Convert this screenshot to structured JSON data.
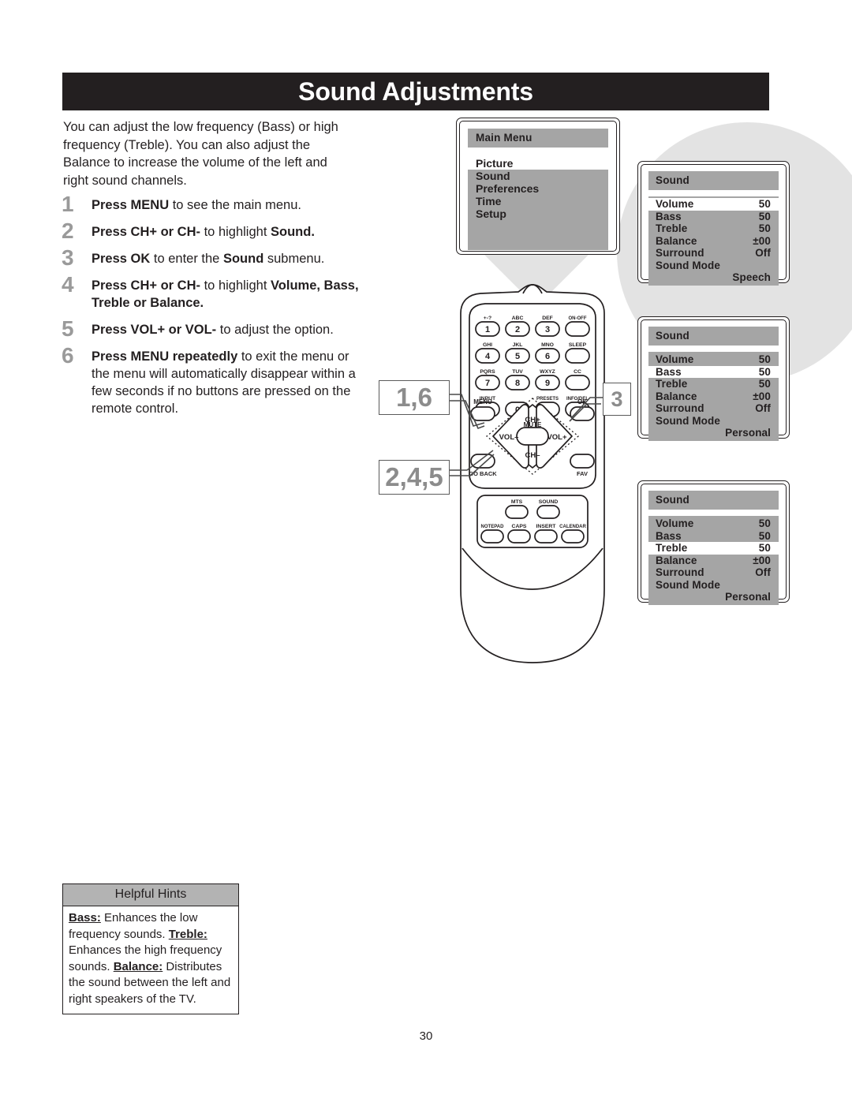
{
  "document": {
    "title": "Sound Adjustments",
    "page_number": "30"
  },
  "intro": {
    "paragraph": "You can adjust the low frequency (Bass) or high frequency (Treble). You can also adjust the Balance to increase the volume of the left and right sound channels."
  },
  "steps": [
    {
      "num": "1",
      "text_html": "<b>Press MENU</b> to see the main menu."
    },
    {
      "num": "2",
      "text_html": "<b>Press CH+ or CH-</b> to highlight <b>Sound.</b>"
    },
    {
      "num": "3",
      "text_html": "<b>Press OK</b> to enter the <b>Sound</b> submenu."
    },
    {
      "num": "4",
      "text_html": "<b>Press CH+ or CH-</b> to highlight <b>Volume, Bass, Treble or Balance.</b>"
    },
    {
      "num": "5",
      "text_html": "<b>Press VOL+ or VOL-</b> to adjust the option."
    },
    {
      "num": "6",
      "text_html": "<b>Press MENU repeatedly</b> to exit the menu or the menu will automatically disappear within a few seconds if no buttons are pressed on the remote control."
    }
  ],
  "callouts": {
    "remote_top": "1,6",
    "remote_nav": "2,4,5",
    "ok_button": "3"
  },
  "main_menu": {
    "title": "Main Menu",
    "items": [
      "Picture",
      "Sound",
      "Preferences",
      "Time",
      "Setup"
    ],
    "highlighted_index": 0
  },
  "sound_panels": [
    {
      "title": "Sound",
      "highlighted": "Volume",
      "rows": [
        {
          "label": "Volume",
          "value": "50"
        },
        {
          "label": "Bass",
          "value": "50"
        },
        {
          "label": "Treble",
          "value": "50"
        },
        {
          "label": "Balance",
          "value": "±00"
        },
        {
          "label": "Surround",
          "value": "Off"
        },
        {
          "label": "Sound Mode",
          "value": ""
        },
        {
          "label": "",
          "value": "Speech"
        }
      ]
    },
    {
      "title": "Sound",
      "highlighted": "Bass",
      "rows": [
        {
          "label": "Volume",
          "value": "50"
        },
        {
          "label": "Bass",
          "value": "50"
        },
        {
          "label": "Treble",
          "value": "50"
        },
        {
          "label": "Balance",
          "value": "±00"
        },
        {
          "label": "Surround",
          "value": "Off"
        },
        {
          "label": "Sound Mode",
          "value": ""
        },
        {
          "label": "",
          "value": "Personal"
        }
      ]
    },
    {
      "title": "Sound",
      "highlighted": "Treble",
      "rows": [
        {
          "label": "Volume",
          "value": "50"
        },
        {
          "label": "Bass",
          "value": "50"
        },
        {
          "label": "Treble",
          "value": "50"
        },
        {
          "label": "Balance",
          "value": "±00"
        },
        {
          "label": "Surround",
          "value": "Off"
        },
        {
          "label": "Sound Mode",
          "value": ""
        },
        {
          "label": "",
          "value": "Personal"
        }
      ]
    }
  ],
  "remote": {
    "keypad": [
      {
        "sub": "+-?",
        "key": "1"
      },
      {
        "sub": "ABC",
        "key": "2"
      },
      {
        "sub": "DEF",
        "key": "3"
      },
      {
        "sub": "ON-OFF",
        "key": ""
      },
      {
        "sub": "GHI",
        "key": "4"
      },
      {
        "sub": "JKL",
        "key": "5"
      },
      {
        "sub": "MNO",
        "key": "6"
      },
      {
        "sub": "SLEEP",
        "key": ""
      },
      {
        "sub": "PQRS",
        "key": "7"
      },
      {
        "sub": "TUV",
        "key": "8"
      },
      {
        "sub": "WXYZ",
        "key": "9"
      },
      {
        "sub": "CC",
        "key": ""
      },
      {
        "sub": "INPUT",
        "key": ""
      },
      {
        "sub": "",
        "key": "0"
      },
      {
        "sub": "PRESETS",
        "key": ""
      },
      {
        "sub": "INFO/DEL",
        "key": ""
      }
    ],
    "nav": {
      "menu": "MENU",
      "ok": "OK",
      "ch_up": "CH+",
      "ch_down": "CH–",
      "vol_down": "VOL–",
      "vol_up": "VOL+",
      "mute": "MUTE",
      "go_back": "GO BACK",
      "fav": "FAV"
    },
    "bottom_buttons": [
      "MTS",
      "SOUND",
      "NOTEPAD",
      "CAPS",
      "INSERT",
      "CALENDAR"
    ]
  },
  "hints": {
    "header": "Helpful Hints",
    "entries": [
      {
        "term": "Bass:",
        "text": " Enhances the low frequency sounds."
      },
      {
        "term": "Treble:",
        "text": " Enhances the high frequency sounds."
      },
      {
        "term": "Balance:",
        "text": " Distributes the sound between the left and right speakers of the TV."
      }
    ]
  },
  "colors": {
    "title_bar": "#231f20",
    "osd_gray": "#a5a5a5",
    "hint_header_gray": "#b3b3b3",
    "deco_circle": "#e3e3e3",
    "callout_number": "#8c8c8c"
  }
}
